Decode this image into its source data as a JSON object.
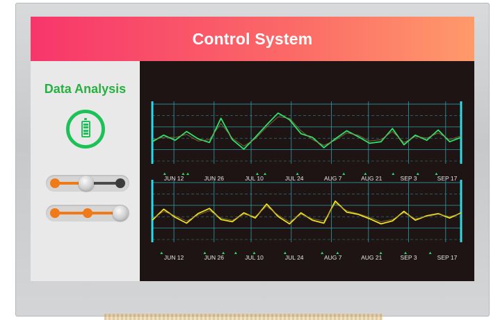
{
  "header": {
    "title": "Control System"
  },
  "sidebar": {
    "title": "Data Analysis"
  },
  "colors": {
    "accent_green": "#1ec158",
    "slider_orange": "#f07a18",
    "grid": "#2a9fa8",
    "line_green": "#2fe36a",
    "line_yellow": "#f2e21a",
    "background": "#1e1413"
  },
  "icons": {
    "battery": "battery-charging-icon"
  },
  "sliders": [
    {
      "name": "slider-1",
      "value": 0.45
    },
    {
      "name": "slider-2",
      "value": 0.95
    }
  ],
  "chart_data": [
    {
      "type": "line",
      "x": [
        "JUN 12",
        "JUN 26",
        "JUL 10",
        "JUL 24",
        "AUG 7",
        "AUG 21",
        "SEP 3",
        "SEP 17"
      ],
      "series": [
        {
          "values": [
            4.0,
            4.9,
            4.2,
            5.4,
            4.4,
            3.9,
            7.2,
            4.3,
            3.0,
            4.6,
            6.3,
            7.9,
            7.0,
            5.1,
            4.6,
            3.2,
            4.4,
            5.5,
            4.7,
            3.8,
            4.0,
            5.8,
            3.6,
            4.9,
            4.2,
            5.6,
            4.0,
            4.6
          ]
        },
        {
          "values": [
            4.3,
            4.6,
            4.6,
            5.0,
            4.1,
            4.3,
            6.5,
            4.5,
            3.4,
            4.4,
            6.0,
            7.4,
            7.2,
            5.5,
            4.3,
            3.5,
            4.2,
            5.2,
            4.9,
            4.1,
            4.3,
            5.4,
            3.9,
            4.7,
            4.5,
            5.2,
            4.3,
            4.8
          ]
        }
      ],
      "grid": true
    },
    {
      "type": "line",
      "x": [
        "JUN 12",
        "JUN 26",
        "JUL 10",
        "JUL 24",
        "AUG 7",
        "AUG 21",
        "SEP 3",
        "SEP 17"
      ],
      "series": [
        {
          "values": [
            4.0,
            5.5,
            4.4,
            3.6,
            4.9,
            5.6,
            4.1,
            3.8,
            5.0,
            4.3,
            6.2,
            4.5,
            3.5,
            5.0,
            4.0,
            3.6,
            6.6,
            5.1,
            4.8,
            4.2,
            3.5,
            3.9,
            5.2,
            4.0,
            4.6,
            4.9,
            4.3,
            5.0
          ]
        },
        {
          "values": [
            4.2,
            5.2,
            4.6,
            3.9,
            4.7,
            5.3,
            4.3,
            4.0,
            4.8,
            4.5,
            5.9,
            4.7,
            3.8,
            4.8,
            4.2,
            3.9,
            6.3,
            5.3,
            4.9,
            4.4,
            3.8,
            4.1,
            5.0,
            4.2,
            4.5,
            4.8,
            4.5,
            4.9
          ]
        }
      ],
      "grid": true
    }
  ]
}
